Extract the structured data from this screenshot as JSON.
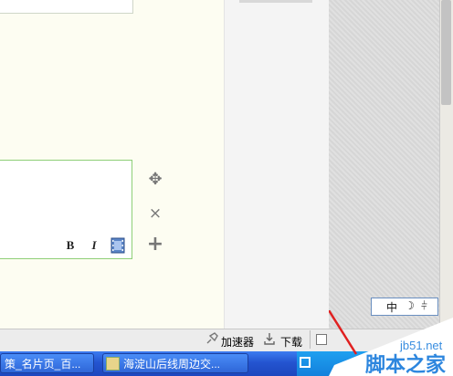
{
  "editor": {
    "format_buttons": {
      "bold": "B",
      "italic": "I"
    }
  },
  "side_icons": {
    "move": "✥",
    "close": "×",
    "add": "+"
  },
  "ime_bar": {
    "lang": "中",
    "moon": "☽",
    "split": "⫩"
  },
  "status_bar": {
    "accelerator_label": "加速器",
    "download_label": "下载"
  },
  "taskbar": {
    "tasks": [
      {
        "label": "策_名片页_百..."
      },
      {
        "label": "海淀山后线周边交..."
      }
    ]
  },
  "watermark": {
    "site": "jb51.net",
    "brand": "脚本之家"
  },
  "colors": {
    "editor_bg": "#fdfdf2",
    "comment_border": "#8ecf77",
    "taskbar_blue": "#2454d0",
    "annotation_red": "#e02020"
  }
}
